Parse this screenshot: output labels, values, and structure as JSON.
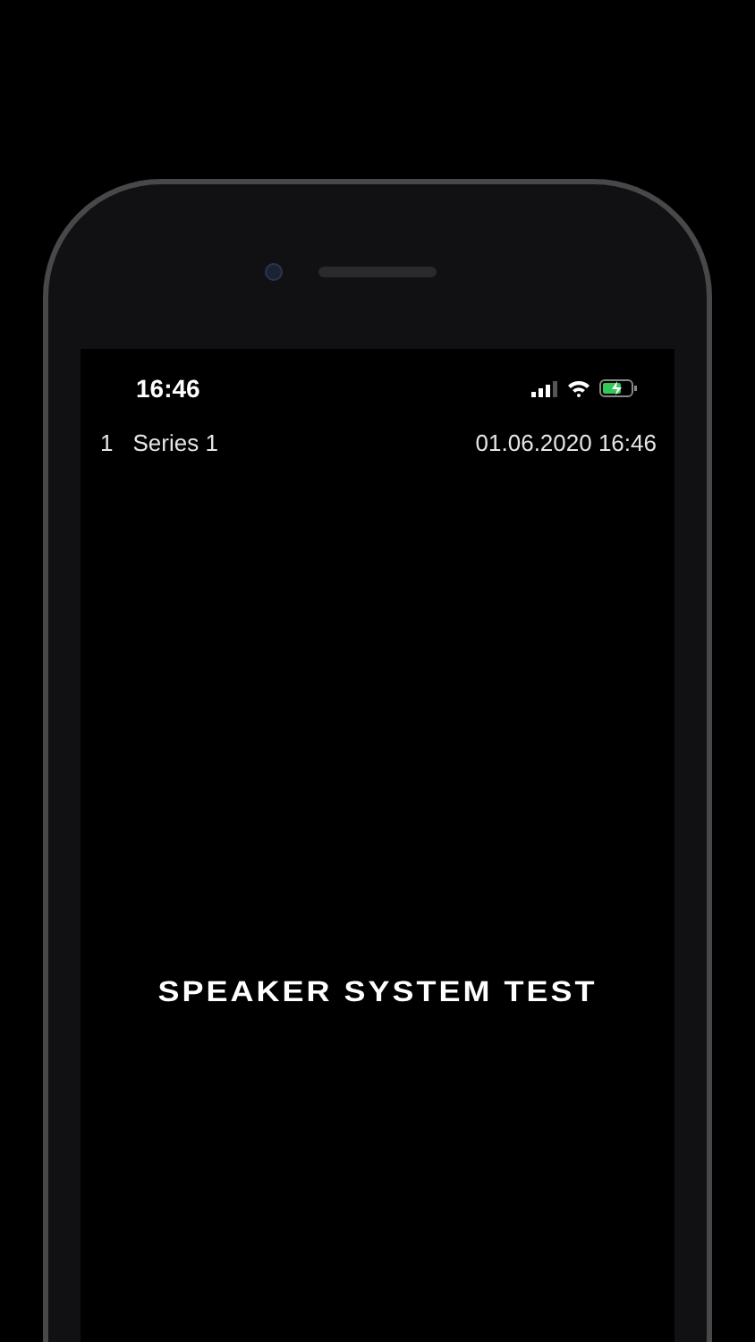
{
  "status_bar": {
    "time": "16:46"
  },
  "series": [
    {
      "index": "1",
      "name": "Series 1",
      "timestamp": "01.06.2020 16:46"
    }
  ],
  "title": "SPEAKER SYSTEM TEST"
}
